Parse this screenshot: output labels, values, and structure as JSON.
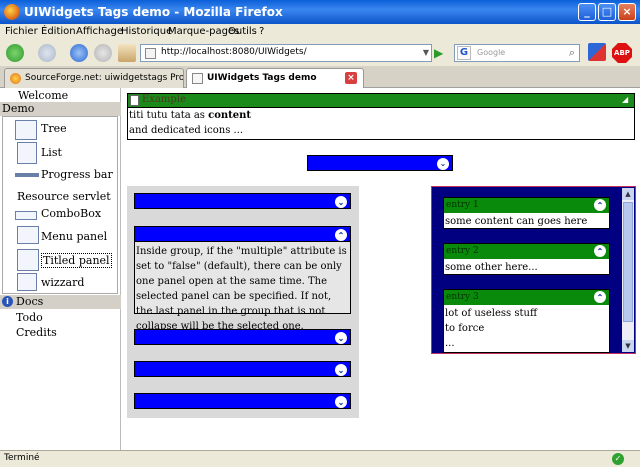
{
  "window": {
    "title": "UIWidgets Tags demo - Mozilla Firefox"
  },
  "menubar": [
    "Fichier",
    "Édition",
    "Affichage",
    "Historique",
    "Marque-pages",
    "Outils",
    "?"
  ],
  "navbar": {
    "url": "http://localhost:8080/UIWidgets/",
    "search_placeholder": "Google",
    "adblock_label": "ABP"
  },
  "tabs": [
    {
      "label": "SourceForge.net: uiwidgetstags Project: ..."
    },
    {
      "label": "UIWidgets Tags demo"
    }
  ],
  "sidebar": {
    "welcome": "Welcome",
    "demo_header": "Demo",
    "demo_items": [
      "Tree",
      "List",
      "Progress bar",
      "Resource servlet",
      "ComboBox",
      "Menu panel",
      "Titled panel",
      "wizzard"
    ],
    "docs_header": "Docs",
    "docs_items": [
      "Todo",
      "Credits"
    ]
  },
  "example": {
    "header": "Example",
    "line1_prefix": "titi tutu tata as ",
    "line1_bold": "content",
    "line2": "and dedicated icons ..."
  },
  "group_panel": {
    "body": "Inside group, if the \"multiple\" attribute is set to \"false\" (default), there can be only one panel open at the same time. The selected panel can be specified. If not, the last panel in the group that is not collapse will be the selected one."
  },
  "tabbed_panel": {
    "entries": [
      {
        "title": "entry 1",
        "lines": [
          "some content can goes here"
        ]
      },
      {
        "title": "entry 2",
        "lines": [
          "some other here..."
        ]
      },
      {
        "title": "entry 3",
        "lines": [
          "lot of useless stuff",
          "to force",
          "..."
        ]
      }
    ]
  },
  "status": {
    "text": "Terminé"
  },
  "colors": {
    "green_header": "#1a8a1a",
    "blue_bar": "#0000ff",
    "navy": "#000080"
  }
}
